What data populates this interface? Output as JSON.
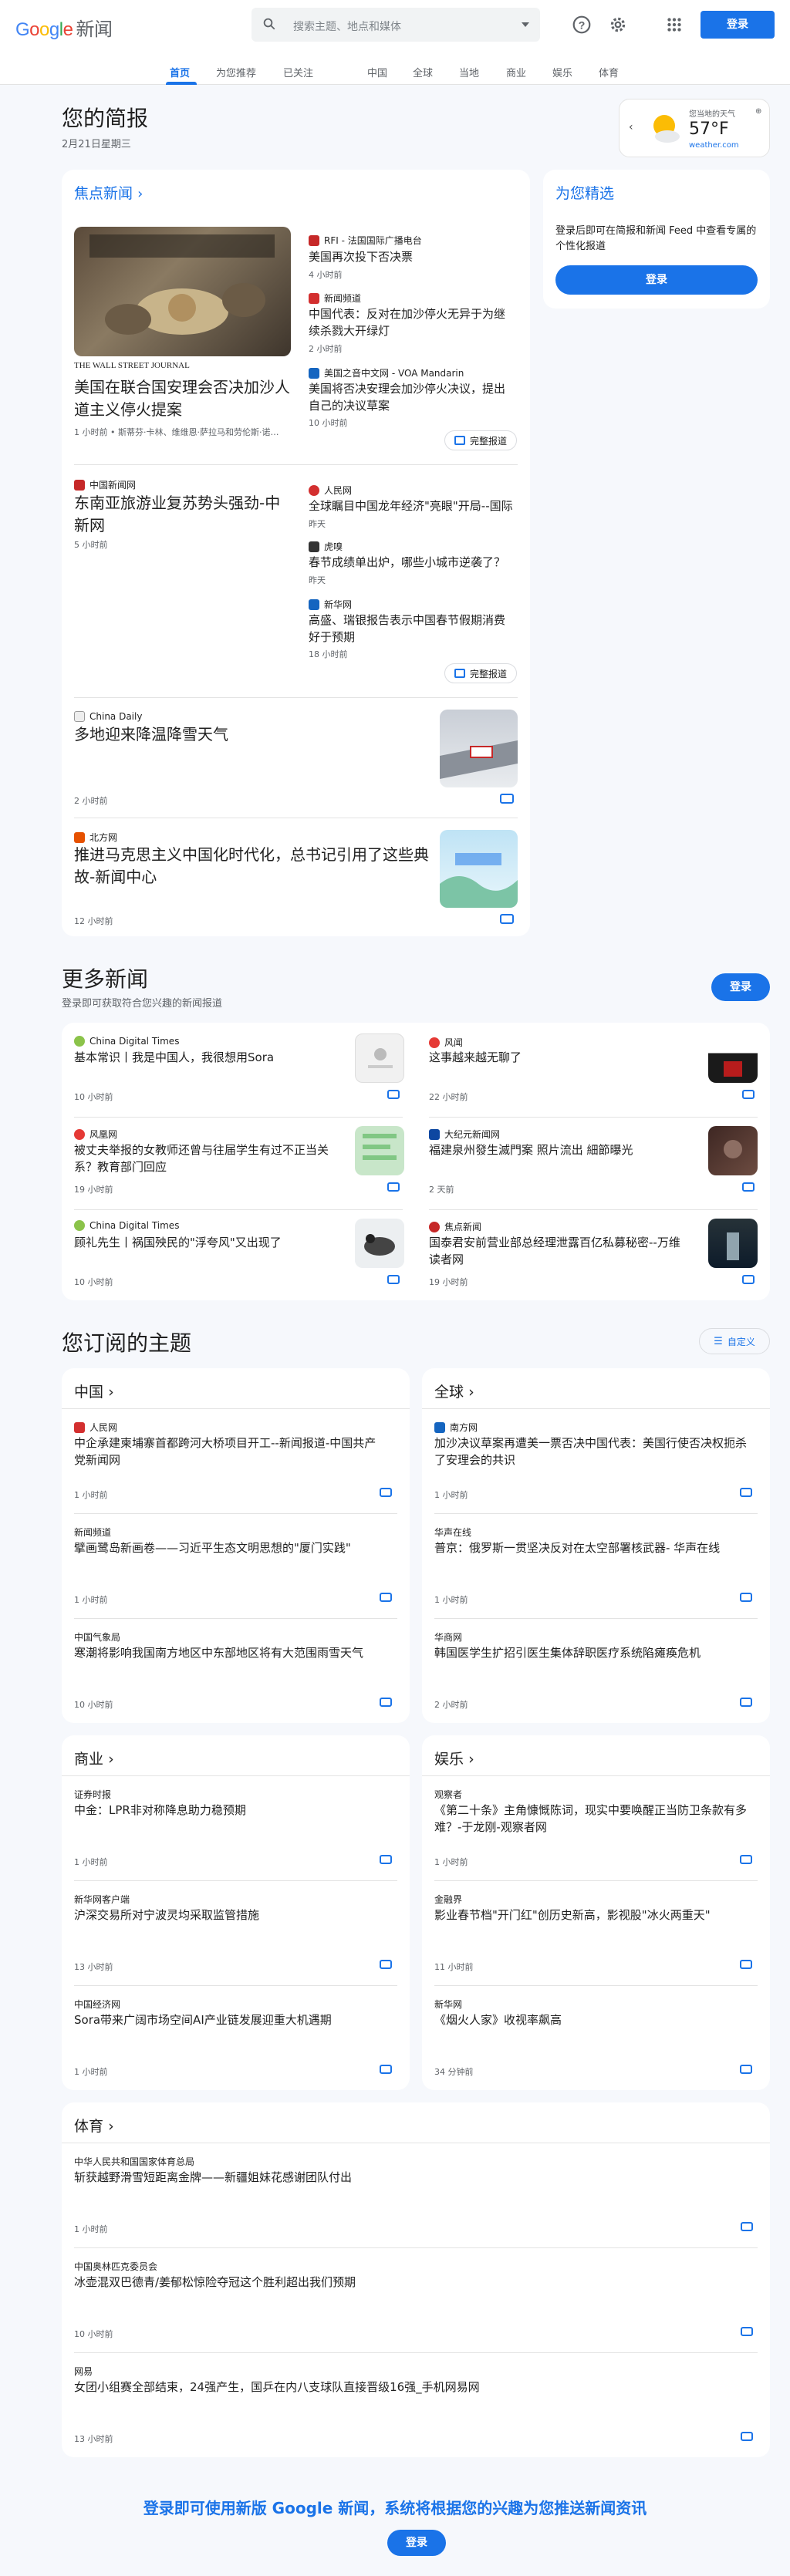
{
  "header": {
    "logo": "Google",
    "logo_suffix": "新闻",
    "search_placeholder": "搜索主题、地点和媒体",
    "login": "登录"
  },
  "nav": [
    "首页",
    "为您推荐",
    "已关注",
    "中国",
    "全球",
    "当地",
    "商业",
    "娱乐",
    "体育"
  ],
  "briefing": {
    "title": "您的简报",
    "date": "2月21日星期三"
  },
  "weather": {
    "label": "您当地的天气",
    "temp": "57°F",
    "source": "weather.com"
  },
  "top_stories": {
    "title": "焦点新闻",
    "main": {
      "source": "THE WALL STREET JOURNAL",
      "headline": "美国在联合国安理会否决加沙人道主义停火提案",
      "meta": "1 小时前 • 斯蒂芬·卡林、维维恩·萨拉马和劳伦斯·诺…"
    },
    "side": [
      {
        "source": "RFI - 法国国际广播电台",
        "headline": "美国再次投下否决票",
        "time": "4 小时前"
      },
      {
        "source": "新闻频道",
        "headline": "中国代表：反对在加沙停火无异于为继续杀戮大开绿灯",
        "time": "2 小时前"
      },
      {
        "source": "美国之音中文网 - VOA Mandarin",
        "headline": "美国将否决安理会加沙停火决议，提出自己的决议草案",
        "time": "10 小时前"
      }
    ],
    "full_coverage": "完整报道",
    "second": {
      "source": "中国新闻网",
      "headline": "东南亚旅游业复苏势头强劲-中新网",
      "time": "5 小时前"
    },
    "second_side": [
      {
        "source": "人民网",
        "headline": "全球瞩目中国龙年经济\"亮眼\"开局--国际",
        "time": "昨天"
      },
      {
        "source": "虎嗅",
        "headline": "春节成绩单出炉，哪些小城市逆袭了？",
        "time": "昨天"
      },
      {
        "source": "新华网",
        "headline": "高盛、瑞银报告表示中国春节假期消费好于预期",
        "time": "18 小时前"
      }
    ],
    "third": {
      "source": "China Daily",
      "headline": "多地迎来降温降雪天气",
      "time": "2 小时前"
    },
    "fourth": {
      "source": "北方网",
      "headline": "推进马克思主义中国化时代化，总书记引用了这些典故-新闻中心",
      "time": "12 小时前"
    }
  },
  "picks": {
    "title": "为您精选",
    "text": "登录后即可在简报和新闻 Feed 中查看专属的个性化报道",
    "login": "登录"
  },
  "more": {
    "title": "更多新闻",
    "sub": "登录即可获取符合您兴趣的新闻报道",
    "login": "登录",
    "items": [
      {
        "source": "China Digital Times",
        "headline": "基本常识丨我是中国人，我很想用Sora",
        "time": "10 小时前"
      },
      {
        "source": "风闻",
        "headline": "这事越来越无聊了",
        "time": "22 小时前"
      },
      {
        "source": "风凰网",
        "headline": "被丈夫举报的女教师还曾与往届学生有过不正当关系？教育部门回应",
        "time": "19 小时前"
      },
      {
        "source": "大纪元新闻网",
        "headline": "福建泉州發生滅門案 照片流出 細節曝光",
        "time": "2 天前"
      },
      {
        "source": "China Digital Times",
        "headline": "顾礼先生丨祸国殃民的\"浮夸风\"又出现了",
        "time": "10 小时前"
      },
      {
        "source": "焦点新闻",
        "headline": "国泰君安前营业部总经理泄露百亿私募秘密--万维读者网",
        "time": "19 小时前"
      }
    ]
  },
  "topics": {
    "title": "您订阅的主题",
    "customize": "自定义",
    "china": {
      "title": "中国",
      "items": [
        {
          "source": "人民网",
          "headline": "中企承建柬埔寨首都跨河大桥项目开工--新闻报道-中国共产党新闻网",
          "time": "1 小时前"
        },
        {
          "source": "新闻频道",
          "headline": "擘画鹭岛新画卷——习近平生态文明思想的\"厦门实践\"",
          "time": "1 小时前"
        },
        {
          "source": "中国气象局",
          "headline": "寒潮将影响我国南方地区中东部地区将有大范围雨雪天气",
          "time": "10 小时前"
        }
      ]
    },
    "world": {
      "title": "全球",
      "items": [
        {
          "source": "南方网",
          "headline": "加沙决议草案再遭美一票否决中国代表：美国行使否决权扼杀了安理会的共识",
          "time": "1 小时前"
        },
        {
          "source": "华声在线",
          "headline": "普京：俄罗斯一贯坚决反对在太空部署核武器- 华声在线",
          "time": "1 小时前"
        },
        {
          "source": "华商网",
          "headline": "韩国医学生扩招引医生集体辞职医疗系统陷瘫痪危机",
          "time": "2 小时前"
        }
      ]
    },
    "business": {
      "title": "商业",
      "items": [
        {
          "source": "证券时报",
          "headline": "中金：LPR非对称降息助力稳预期",
          "time": "1 小时前"
        },
        {
          "source": "新华网客户端",
          "headline": "沪深交易所对宁波灵均采取监管措施",
          "time": "13 小时前"
        },
        {
          "source": "中国经济网",
          "headline": "Sora带来广阔市场空间AI产业链发展迎重大机遇期",
          "time": "1 小时前"
        }
      ]
    },
    "ent": {
      "title": "娱乐",
      "items": [
        {
          "source": "观察者",
          "headline": "《第二十条》主角慷慨陈词，现实中要唤醒正当防卫条款有多难？-于龙刚-观察者网",
          "time": "1 小时前"
        },
        {
          "source": "金融界",
          "headline": "影业春节档\"开门红\"创历史新高，影视股\"冰火两重天\"",
          "time": "11 小时前"
        },
        {
          "source": "新华网",
          "headline": "《烟火人家》收视率飙高",
          "time": "34 分钟前"
        }
      ]
    },
    "sports": {
      "title": "体育",
      "items": [
        {
          "source": "中华人民共和国国家体育总局",
          "headline": "斩获越野滑雪短距离金牌——新疆姐妹花感谢团队付出",
          "time": "1 小时前"
        },
        {
          "source": "中国奥林匹克委员会",
          "headline": "冰壶混双巴德青/姜郁松惊险夺冠这个胜利超出我们预期",
          "time": "10 小时前"
        },
        {
          "source": "网易",
          "headline": "女团小组赛全部结束，24强产生，国乒在内八支球队直接晋级16强_手机网易网",
          "time": "13 小时前"
        }
      ]
    }
  },
  "footer": {
    "text": "登录即可使用新版 Google 新闻，系统将根据您的兴趣为您推送新闻资讯",
    "login": "登录"
  },
  "colors": {
    "accent": "#1a73e8",
    "background": "#f6f8fc"
  }
}
